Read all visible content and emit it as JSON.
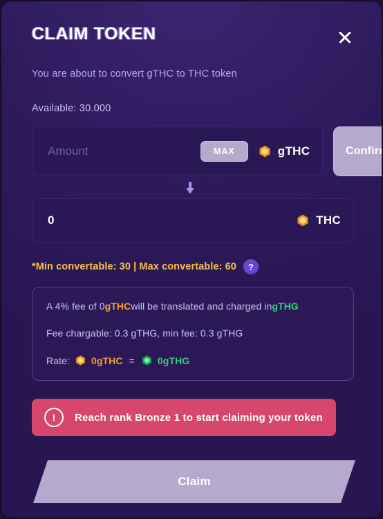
{
  "modal": {
    "title": "CLAIM TOKEN",
    "close_icon": "close-icon",
    "subtitle": "You are about to convert gTHC to THC token",
    "available_label": "Available: 30.000"
  },
  "amount_row": {
    "input_placeholder": "Amount",
    "input_value": "",
    "max_label": "MAX",
    "token_icon": "gold-gem-icon",
    "token_name": "gTHC",
    "confirm_label": "Confirm"
  },
  "arrow_icon": "arrow-down-icon",
  "output_row": {
    "value": "0",
    "token_icon": "gold-gem-icon",
    "token_name": "THC"
  },
  "convertable": {
    "text": "*Min convertable: 30 | Max convertable: 60",
    "min": "30",
    "max": "60",
    "help_label": "?"
  },
  "info": {
    "fee_line": {
      "part1": "A 4% fee of 0 ",
      "token_from": "gTHC",
      "part2": " will be translated and charged in ",
      "token_to": "gTHG"
    },
    "fee_chargable": "Fee chargable: 0.3  gTHG, min fee: 0.3 gTHG",
    "rate": {
      "label": "Rate:",
      "from_icon": "gold-gem-icon",
      "from_value": "0gTHC",
      "equals": "=",
      "to_icon": "green-gem-icon",
      "to_value": "0gTHG"
    }
  },
  "warning": {
    "icon": "exclamation-circle-icon",
    "text": "Reach rank Bronze 1 to start claiming your token"
  },
  "claim": {
    "label": "Claim"
  },
  "colors": {
    "modal_bg": "#2e1b5c",
    "field_bg": "#2a1755",
    "accent_gold": "#f5c24a",
    "accent_orange": "#f2a22e",
    "accent_green": "#35d17a",
    "warning_bg": "#d6466d",
    "button_lavender": "#b3aacd",
    "help_purple": "#6b44d6"
  }
}
